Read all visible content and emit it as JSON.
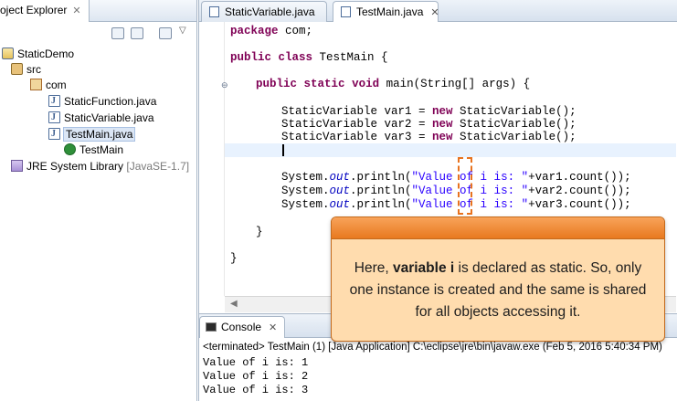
{
  "explorer": {
    "tab_label": "oject Explorer",
    "tab_close": "✕",
    "tree": [
      {
        "label": "StaticDemo",
        "icon": "project-icon"
      },
      {
        "label": "src",
        "icon": "source-folder-icon"
      },
      {
        "label": "com",
        "icon": "package-icon"
      },
      {
        "label": "StaticFunction.java",
        "icon": "java-file-icon"
      },
      {
        "label": "StaticVariable.java",
        "icon": "java-file-icon"
      },
      {
        "label": "TestMain.java",
        "icon": "java-file-icon"
      },
      {
        "label": "TestMain",
        "icon": "class-icon"
      },
      {
        "label": "JRE System Library",
        "suffix": "[JavaSE-1.7]",
        "icon": "library-icon"
      }
    ]
  },
  "editor": {
    "tabs": [
      {
        "label": "StaticVariable.java",
        "active": false
      },
      {
        "label": "TestMain.java",
        "active": true,
        "close": "✕"
      }
    ],
    "lines": {
      "l1_kw": "package",
      "l1_rest": " com;",
      "l2_kw1": "public",
      "l2_kw2": "class",
      "l2_rest": " TestMain {",
      "l3_kw1": "public",
      "l3_kw2": "static",
      "l3_kw3": "void",
      "l3_rest": " main(String[] args) {",
      "l4_a": "StaticVariable var1 = ",
      "l4_kw": "new",
      "l4_b": " StaticVariable();",
      "l5_a": "StaticVariable var2 = ",
      "l5_kw": "new",
      "l5_b": " StaticVariable();",
      "l6_a": "StaticVariable var3 = ",
      "l6_kw": "new",
      "l6_b": " StaticVariable();",
      "p1_a": "System.",
      "p1_out": "out",
      "p1_b": ".println(",
      "p1_str": "\"Value of i is: \"",
      "p1_c": "+var1.count());",
      "p2_a": "System.",
      "p2_out": "out",
      "p2_b": ".println(",
      "p2_str": "\"Value of i is: \"",
      "p2_c": "+var2.count());",
      "p3_a": "System.",
      "p3_out": "out",
      "p3_b": ".println(",
      "p3_str": "\"Value of i is: \"",
      "p3_c": "+var3.count());",
      "close1": "}",
      "close2": "}"
    }
  },
  "console": {
    "tab_label": "Console",
    "tab_close": "✕",
    "status": "<terminated> TestMain (1) [Java Application] C:\\eclipse\\jre\\bin\\javaw.exe (Feb 5, 2016 5:40:34 PM)",
    "output": [
      "Value of i is: 1",
      "Value of i is: 2",
      "Value of i is: 3"
    ]
  },
  "callout": {
    "pre": "Here, ",
    "bold": "variable i",
    "post": " is declared as static. So, only one instance is created and the same is shared for all objects accessing it."
  },
  "colors": {
    "keyword": "#7f0055",
    "string": "#2a00ff",
    "static_field": "#0000c0",
    "callout_header": "#e8791f",
    "callout_body": "#ffdcae"
  }
}
